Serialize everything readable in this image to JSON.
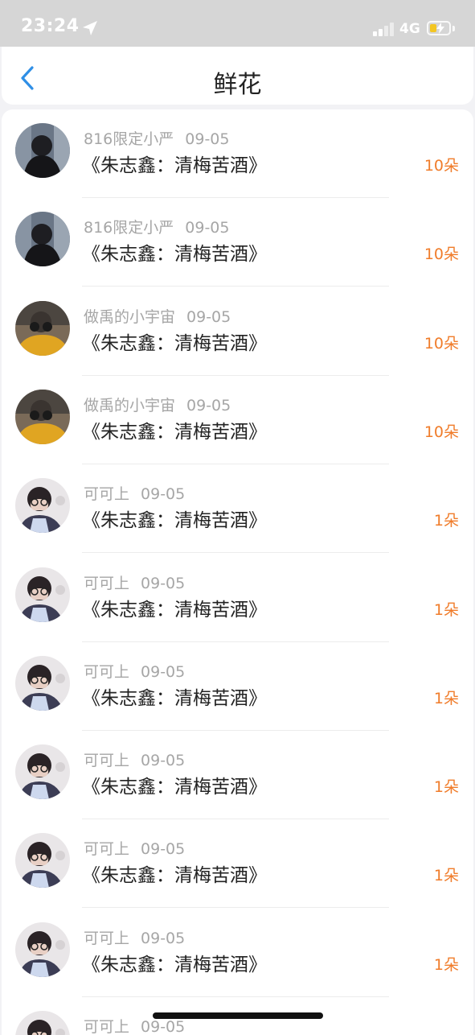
{
  "status_bar": {
    "time": "23:24",
    "network": "4G"
  },
  "nav": {
    "title": "鲜花"
  },
  "list": [
    {
      "user": "816限定小严",
      "date": "09-05",
      "title": "《朱志鑫：清梅苦酒》",
      "count": "10朵",
      "avatar": "dark"
    },
    {
      "user": "816限定小严",
      "date": "09-05",
      "title": "《朱志鑫：清梅苦酒》",
      "count": "10朵",
      "avatar": "dark"
    },
    {
      "user": "做禹的小宇宙",
      "date": "09-05",
      "title": "《朱志鑫：清梅苦酒》",
      "count": "10朵",
      "avatar": "yellow"
    },
    {
      "user": "做禹的小宇宙",
      "date": "09-05",
      "title": "《朱志鑫：清梅苦酒》",
      "count": "10朵",
      "avatar": "yellow"
    },
    {
      "user": "可可上",
      "date": "09-05",
      "title": "《朱志鑫：清梅苦酒》",
      "count": "1朵",
      "avatar": "glasses"
    },
    {
      "user": "可可上",
      "date": "09-05",
      "title": "《朱志鑫：清梅苦酒》",
      "count": "1朵",
      "avatar": "glasses"
    },
    {
      "user": "可可上",
      "date": "09-05",
      "title": "《朱志鑫：清梅苦酒》",
      "count": "1朵",
      "avatar": "glasses"
    },
    {
      "user": "可可上",
      "date": "09-05",
      "title": "《朱志鑫：清梅苦酒》",
      "count": "1朵",
      "avatar": "glasses"
    },
    {
      "user": "可可上",
      "date": "09-05",
      "title": "《朱志鑫：清梅苦酒》",
      "count": "1朵",
      "avatar": "glasses"
    },
    {
      "user": "可可上",
      "date": "09-05",
      "title": "《朱志鑫：清梅苦酒》",
      "count": "1朵",
      "avatar": "glasses"
    },
    {
      "user": "可可上",
      "date": "09-05",
      "title": "",
      "count": "",
      "avatar": "glasses"
    }
  ],
  "colors": {
    "accent_blue": "#2f8fe6",
    "count_orange": "#f07c2a",
    "meta_gray": "#a6a6a6",
    "title_black": "#222222"
  },
  "icons": {
    "back": "chevron-left-icon",
    "location": "location-arrow-icon",
    "signal": "signal-bars-icon",
    "battery": "battery-charging-icon"
  }
}
